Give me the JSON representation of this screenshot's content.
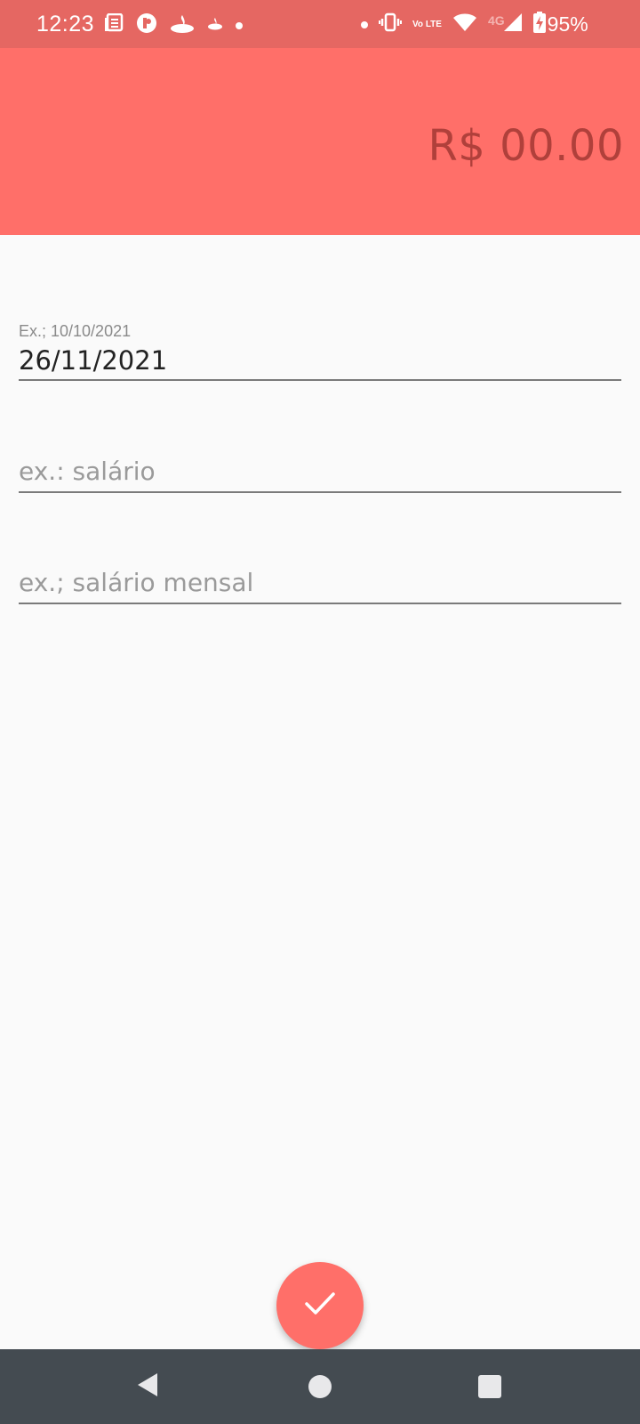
{
  "status_bar": {
    "time": "12:23",
    "network": "4G",
    "volte": "Vo LTE",
    "battery": "95%",
    "left_icons": [
      "news-icon",
      "app-r-icon",
      "santander-icon",
      "santander-small-icon",
      "dot-icon"
    ],
    "right_icons": [
      "dot-icon",
      "vibrate-icon",
      "volte-icon",
      "wifi-icon",
      "signal-icon",
      "battery-charging-icon"
    ]
  },
  "header": {
    "amount": "R$ 00.00"
  },
  "form": {
    "date_label": "Ex.; 10/10/2021",
    "date_value": "26/11/2021",
    "description_placeholder": "ex.: salário",
    "detail_placeholder": "ex.; salário mensal"
  },
  "fab": {
    "icon": "check-icon"
  },
  "nav": {
    "back_icon": "back-triangle-icon",
    "home_icon": "home-circle-icon",
    "recent_icon": "recent-square-icon"
  },
  "colors": {
    "status_bar": "#e56762",
    "header": "#ff6f69",
    "amount_text": "#b0403b",
    "fab": "#ff6f69",
    "nav_bar": "#444b51",
    "background": "#fafafa"
  }
}
